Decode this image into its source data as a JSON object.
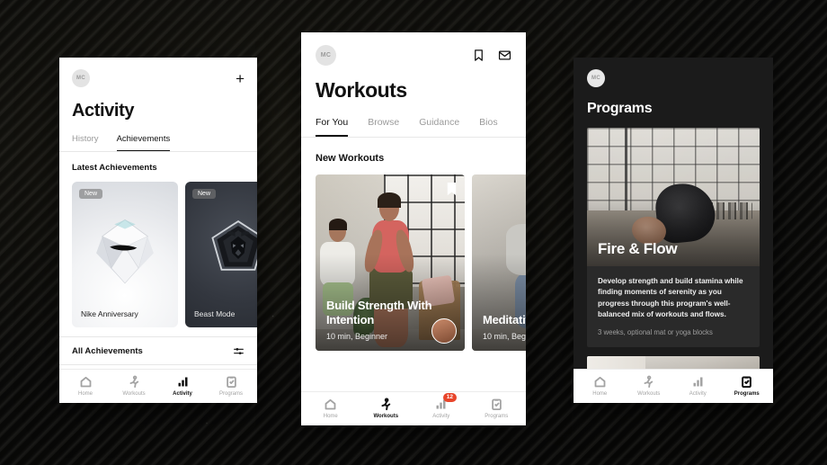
{
  "scene": {
    "background_color": "#0a0a09",
    "accent_badge_color": "#e8452b"
  },
  "phone_activity": {
    "avatar_initials": "MC",
    "add_button": "+",
    "title": "Activity",
    "tabs": [
      {
        "label": "History",
        "active": false
      },
      {
        "label": "Achievements",
        "active": true
      }
    ],
    "section_title": "Latest Achievements",
    "achievements": [
      {
        "badge": "New",
        "name": "Nike Anniversary",
        "theme": "light"
      },
      {
        "badge": "New",
        "name": "Beast Mode",
        "theme": "dark"
      }
    ],
    "all_achievements_label": "All Achievements",
    "filter_icon": "sliders-icon",
    "nav": [
      {
        "label": "Home",
        "icon": "home-icon",
        "active": false
      },
      {
        "label": "Workouts",
        "icon": "runner-icon",
        "active": false
      },
      {
        "label": "Activity",
        "icon": "bar-chart-icon",
        "active": true
      },
      {
        "label": "Programs",
        "icon": "clipboard-check-icon",
        "active": false
      }
    ]
  },
  "phone_workouts": {
    "avatar_initials": "MC",
    "header_icons": [
      {
        "name": "bookmark-icon"
      },
      {
        "name": "mail-icon"
      }
    ],
    "title": "Workouts",
    "tabs": [
      {
        "label": "For You",
        "active": true
      },
      {
        "label": "Browse",
        "active": false
      },
      {
        "label": "Guidance",
        "active": false
      },
      {
        "label": "Bios",
        "active": false
      }
    ],
    "section_title": "New Workouts",
    "cards": [
      {
        "title": "Build Strength With Intention",
        "meta": "10 min, Beginner",
        "bookmark": "bookmark-icon",
        "has_coach": true
      },
      {
        "title": "Meditative",
        "meta": "10 min, Beg",
        "has_coach": false
      }
    ],
    "nav": [
      {
        "label": "Home",
        "icon": "home-icon",
        "active": false,
        "badge": ""
      },
      {
        "label": "Workouts",
        "icon": "runner-icon",
        "active": true,
        "badge": ""
      },
      {
        "label": "Activity",
        "icon": "bar-chart-icon",
        "active": false,
        "badge": "12"
      },
      {
        "label": "Programs",
        "icon": "clipboard-check-icon",
        "active": false,
        "badge": ""
      }
    ]
  },
  "phone_programs": {
    "avatar_initials": "MC",
    "title": "Programs",
    "program": {
      "name": "Fire & Flow",
      "description": "Develop strength and build stamina while finding moments of serenity as you progress through this program's well-balanced mix of workouts and flows.",
      "details": "3 weeks, optional mat or yoga blocks"
    },
    "nav": [
      {
        "label": "Home",
        "icon": "home-icon",
        "active": false
      },
      {
        "label": "Workouts",
        "icon": "runner-icon",
        "active": false
      },
      {
        "label": "Activity",
        "icon": "bar-chart-icon",
        "active": false
      },
      {
        "label": "Programs",
        "icon": "clipboard-check-icon",
        "active": true
      }
    ]
  }
}
